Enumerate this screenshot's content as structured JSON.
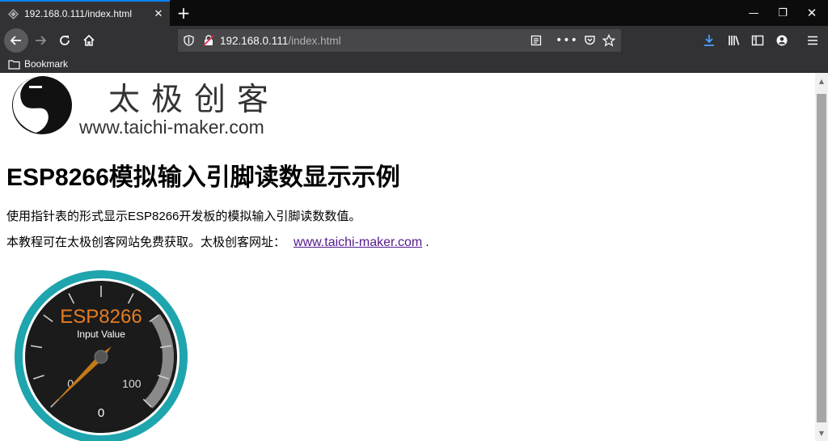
{
  "tab": {
    "title": "192.168.0.111/index.html",
    "close_label": "✕"
  },
  "newtab_label": "+",
  "window": {
    "minimize": "—",
    "restore": "❐",
    "close": "✕"
  },
  "url": {
    "host": "192.168.0.111",
    "path": "/index.html"
  },
  "bookmarks": {
    "item": "Bookmark"
  },
  "logo": {
    "cn": "太极创客",
    "en": "www.taichi-maker.com"
  },
  "page": {
    "heading": "ESP8266模拟输入引脚读数显示示例",
    "desc": "使用指针表的形式显示ESP8266开发板的模拟输入引脚读数数值。",
    "note": "本教程可在太极创客网站免费获取。太极创客网址：",
    "link": "www.taichi-maker.com",
    "note_end": "."
  },
  "gauge": {
    "title": "ESP8266",
    "subtitle": "Input Value",
    "min_label": "0",
    "max_label": "100",
    "value_label": "0",
    "value": 0,
    "min": 0,
    "max": 100,
    "title_color": "#e87d1e",
    "ring_color": "#1ea5ae",
    "needle_color": "#c47a18"
  }
}
